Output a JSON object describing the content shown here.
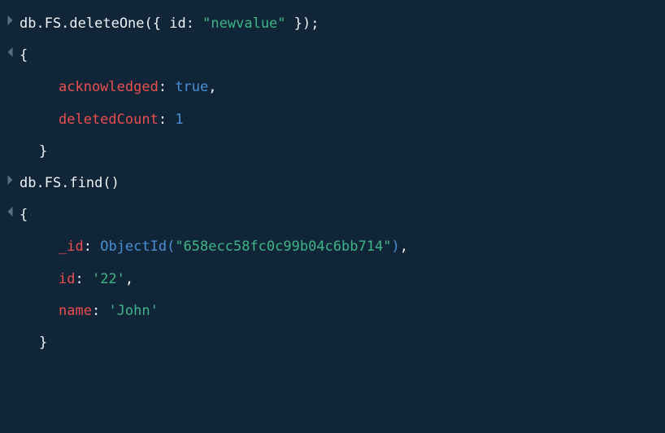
{
  "lines": [
    {
      "gutter": "input",
      "tokens": [
        {
          "text": "db.FS.deleteOne({ id: ",
          "cls": "white"
        },
        {
          "text": "\"newvalue\"",
          "cls": "string-green"
        },
        {
          "text": " });",
          "cls": "white"
        }
      ]
    },
    {
      "gutter": "output",
      "tokens": [
        {
          "text": "{",
          "cls": "white"
        }
      ]
    },
    {
      "gutter": "none",
      "indent": 2,
      "tokens": [
        {
          "text": "acknowledged",
          "cls": "key-red"
        },
        {
          "text": ": ",
          "cls": "punct"
        },
        {
          "text": "true",
          "cls": "value-blue"
        },
        {
          "text": ",",
          "cls": "punct"
        }
      ]
    },
    {
      "gutter": "none",
      "indent": 2,
      "tokens": [
        {
          "text": "deletedCount",
          "cls": "key-red"
        },
        {
          "text": ": ",
          "cls": "punct"
        },
        {
          "text": "1",
          "cls": "value-blue"
        }
      ]
    },
    {
      "gutter": "none",
      "indent": 1,
      "tokens": [
        {
          "text": "}",
          "cls": "white"
        }
      ]
    },
    {
      "gutter": "input",
      "tokens": [
        {
          "text": "db.FS.find()",
          "cls": "white"
        }
      ]
    },
    {
      "gutter": "output",
      "tokens": [
        {
          "text": "{",
          "cls": "white"
        }
      ]
    },
    {
      "gutter": "none",
      "indent": 2,
      "tokens": [
        {
          "text": "_id",
          "cls": "key-red"
        },
        {
          "text": ": ",
          "cls": "punct"
        },
        {
          "text": "ObjectId(",
          "cls": "objid-blue"
        },
        {
          "text": "\"658ecc58fc0c99b04c6bb714\"",
          "cls": "string-green"
        },
        {
          "text": ")",
          "cls": "objid-blue"
        },
        {
          "text": ",",
          "cls": "punct"
        }
      ]
    },
    {
      "gutter": "none",
      "indent": 2,
      "tokens": [
        {
          "text": "id",
          "cls": "key-red"
        },
        {
          "text": ": ",
          "cls": "punct"
        },
        {
          "text": "'22'",
          "cls": "string-green"
        },
        {
          "text": ",",
          "cls": "punct"
        }
      ]
    },
    {
      "gutter": "none",
      "indent": 2,
      "tokens": [
        {
          "text": "name",
          "cls": "key-red"
        },
        {
          "text": ": ",
          "cls": "punct"
        },
        {
          "text": "'John'",
          "cls": "string-green"
        }
      ]
    },
    {
      "gutter": "none",
      "indent": 1,
      "tokens": [
        {
          "text": "}",
          "cls": "white"
        }
      ]
    }
  ]
}
